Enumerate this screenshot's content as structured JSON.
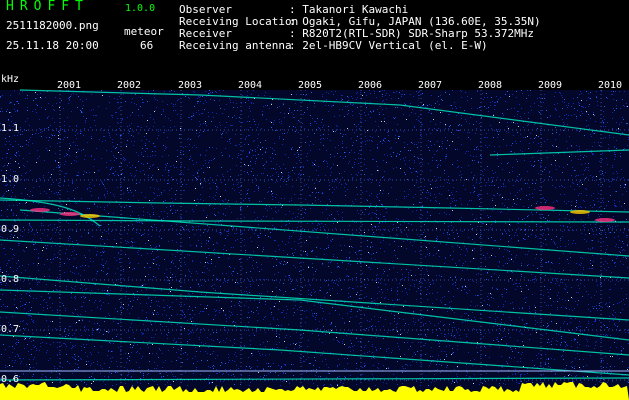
{
  "header": {
    "app_title": "HROFFT",
    "version": "1.0.0",
    "filename": "2511182000.png",
    "meteor_label": "meteor",
    "datetime": "25.11.18 20:00",
    "meteor_count": "66",
    "info": [
      {
        "label": "Observer",
        "value": ": Takanori Kawachi"
      },
      {
        "label": "Receiving Location",
        "value": ": Ogaki, Gifu, JAPAN (136.60E, 35.35N)"
      },
      {
        "label": "Receiver",
        "value": ": R820T2(RTL-SDR) SDR-Sharp 53.372MHz"
      },
      {
        "label": "Receiving antenna",
        "value": ": 2el-HB9CV Vertical (el. E-W)"
      }
    ]
  },
  "colors": {
    "header_green": "#00ff00",
    "background": "#000000",
    "noise": "#1030c0",
    "trace": "#00ffcc",
    "echo_bar": "#ffff00"
  },
  "chart_data": {
    "type": "heatmap",
    "ylabel": "kHz",
    "yticks": [
      "1.1",
      "1.0",
      "0.9",
      "0.8",
      "0.7",
      "0.6"
    ],
    "xticks": [
      "2001",
      "2002",
      "2003",
      "2004",
      "2005",
      "2006",
      "2007",
      "2008",
      "2009",
      "2010"
    ],
    "grid": true
  }
}
